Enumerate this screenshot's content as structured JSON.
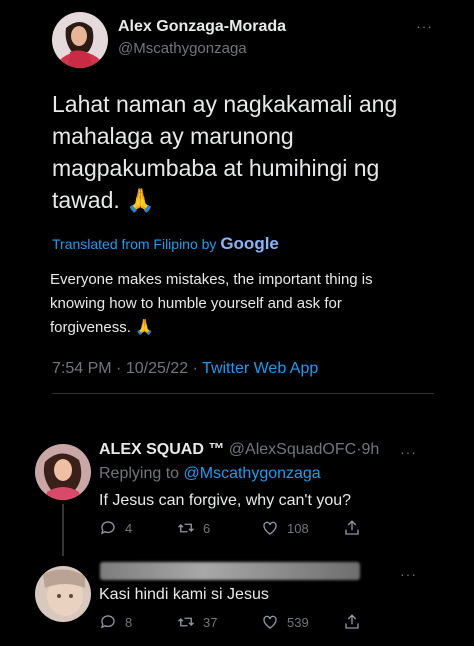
{
  "main_tweet": {
    "author_name": "Alex Gonzaga-Morada",
    "author_handle": "@Mscathygonzaga",
    "more_label": "···",
    "text_lines": [
      "Lahat naman ay nagkakamali ang",
      "mahalaga ay marunong",
      "magpakumbaba at humihingi ng",
      "tawad. 🙏"
    ],
    "translated_label": "Translated from Filipino by",
    "google_brand": "Google",
    "translation_lines": [
      "Everyone makes mistakes, the important thing is",
      "knowing how to humble yourself and ask for",
      "forgiveness. 🙏"
    ],
    "time": "7:54 PM",
    "date": "10/25/22",
    "source": "Twitter Web App",
    "separator": "·"
  },
  "reply_1": {
    "author_name": "ALEX SQUAD ™",
    "author_handle": "@AlexSquadOFC",
    "age": "9h",
    "replying_label": "Replying to",
    "replying_handle": "@Mscathygonzaga",
    "text": "If Jesus can forgive, why can't you?",
    "replies": "4",
    "retweets": "6",
    "likes": "108",
    "more_label": "···"
  },
  "reply_2": {
    "text": "Kasi hindi kami si Jesus",
    "replies": "8",
    "retweets": "37",
    "likes": "539",
    "more_label": "···"
  },
  "colors": {
    "background": "#000000",
    "text": "#e7e9ea",
    "muted": "#71767b",
    "link": "#1d9bf0"
  }
}
